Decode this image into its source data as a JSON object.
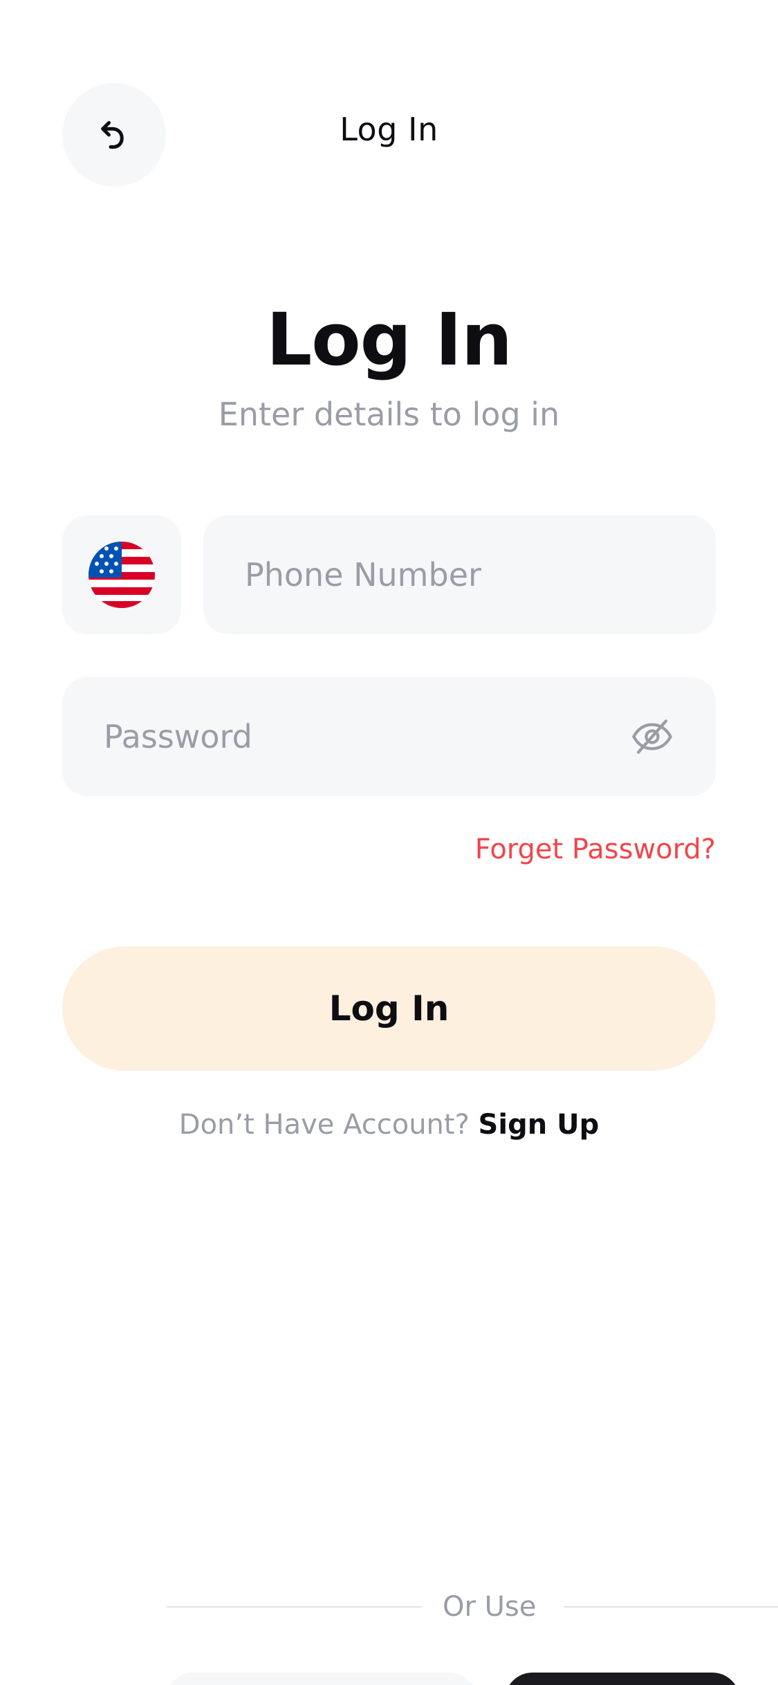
{
  "header": {
    "title": "Log In",
    "back_icon": "undo-arrow-icon"
  },
  "main": {
    "heading": "Log In",
    "subheading": "Enter details to log in",
    "country": {
      "flag_icon": "us-flag-icon"
    },
    "phone": {
      "placeholder": "Phone Number",
      "value": ""
    },
    "password": {
      "placeholder": "Password",
      "value": "",
      "toggle_icon": "eye-off-icon"
    },
    "forgot_password": "Forget Password?",
    "login_button": "Log In",
    "signup_prompt": "Don’t Have Account?",
    "signup_link": "Sign Up"
  },
  "footer": {
    "or_use": "Or Use"
  },
  "colors": {
    "accent_red": "#F0464B",
    "button_bg": "#FDF0DF",
    "field_bg": "#F6F7F9",
    "text_primary": "#0D0D12",
    "text_muted": "#9A9CA6"
  }
}
